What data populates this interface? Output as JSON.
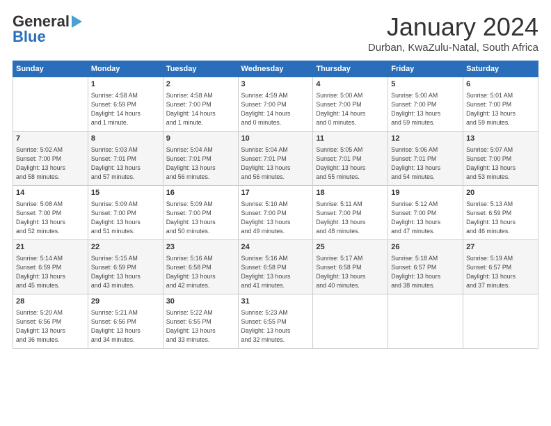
{
  "logo": {
    "general": "General",
    "blue": "Blue"
  },
  "title": "January 2024",
  "subtitle": "Durban, KwaZulu-Natal, South Africa",
  "days_header": [
    "Sunday",
    "Monday",
    "Tuesday",
    "Wednesday",
    "Thursday",
    "Friday",
    "Saturday"
  ],
  "weeks": [
    [
      {
        "day": "",
        "info": ""
      },
      {
        "day": "1",
        "info": "Sunrise: 4:58 AM\nSunset: 6:59 PM\nDaylight: 14 hours\nand 1 minute."
      },
      {
        "day": "2",
        "info": "Sunrise: 4:58 AM\nSunset: 7:00 PM\nDaylight: 14 hours\nand 1 minute."
      },
      {
        "day": "3",
        "info": "Sunrise: 4:59 AM\nSunset: 7:00 PM\nDaylight: 14 hours\nand 0 minutes."
      },
      {
        "day": "4",
        "info": "Sunrise: 5:00 AM\nSunset: 7:00 PM\nDaylight: 14 hours\nand 0 minutes."
      },
      {
        "day": "5",
        "info": "Sunrise: 5:00 AM\nSunset: 7:00 PM\nDaylight: 13 hours\nand 59 minutes."
      },
      {
        "day": "6",
        "info": "Sunrise: 5:01 AM\nSunset: 7:00 PM\nDaylight: 13 hours\nand 59 minutes."
      }
    ],
    [
      {
        "day": "7",
        "info": "Sunrise: 5:02 AM\nSunset: 7:00 PM\nDaylight: 13 hours\nand 58 minutes."
      },
      {
        "day": "8",
        "info": "Sunrise: 5:03 AM\nSunset: 7:01 PM\nDaylight: 13 hours\nand 57 minutes."
      },
      {
        "day": "9",
        "info": "Sunrise: 5:04 AM\nSunset: 7:01 PM\nDaylight: 13 hours\nand 56 minutes."
      },
      {
        "day": "10",
        "info": "Sunrise: 5:04 AM\nSunset: 7:01 PM\nDaylight: 13 hours\nand 56 minutes."
      },
      {
        "day": "11",
        "info": "Sunrise: 5:05 AM\nSunset: 7:01 PM\nDaylight: 13 hours\nand 55 minutes."
      },
      {
        "day": "12",
        "info": "Sunrise: 5:06 AM\nSunset: 7:01 PM\nDaylight: 13 hours\nand 54 minutes."
      },
      {
        "day": "13",
        "info": "Sunrise: 5:07 AM\nSunset: 7:00 PM\nDaylight: 13 hours\nand 53 minutes."
      }
    ],
    [
      {
        "day": "14",
        "info": "Sunrise: 5:08 AM\nSunset: 7:00 PM\nDaylight: 13 hours\nand 52 minutes."
      },
      {
        "day": "15",
        "info": "Sunrise: 5:09 AM\nSunset: 7:00 PM\nDaylight: 13 hours\nand 51 minutes."
      },
      {
        "day": "16",
        "info": "Sunrise: 5:09 AM\nSunset: 7:00 PM\nDaylight: 13 hours\nand 50 minutes."
      },
      {
        "day": "17",
        "info": "Sunrise: 5:10 AM\nSunset: 7:00 PM\nDaylight: 13 hours\nand 49 minutes."
      },
      {
        "day": "18",
        "info": "Sunrise: 5:11 AM\nSunset: 7:00 PM\nDaylight: 13 hours\nand 48 minutes."
      },
      {
        "day": "19",
        "info": "Sunrise: 5:12 AM\nSunset: 7:00 PM\nDaylight: 13 hours\nand 47 minutes."
      },
      {
        "day": "20",
        "info": "Sunrise: 5:13 AM\nSunset: 6:59 PM\nDaylight: 13 hours\nand 46 minutes."
      }
    ],
    [
      {
        "day": "21",
        "info": "Sunrise: 5:14 AM\nSunset: 6:59 PM\nDaylight: 13 hours\nand 45 minutes."
      },
      {
        "day": "22",
        "info": "Sunrise: 5:15 AM\nSunset: 6:59 PM\nDaylight: 13 hours\nand 43 minutes."
      },
      {
        "day": "23",
        "info": "Sunrise: 5:16 AM\nSunset: 6:58 PM\nDaylight: 13 hours\nand 42 minutes."
      },
      {
        "day": "24",
        "info": "Sunrise: 5:16 AM\nSunset: 6:58 PM\nDaylight: 13 hours\nand 41 minutes."
      },
      {
        "day": "25",
        "info": "Sunrise: 5:17 AM\nSunset: 6:58 PM\nDaylight: 13 hours\nand 40 minutes."
      },
      {
        "day": "26",
        "info": "Sunrise: 5:18 AM\nSunset: 6:57 PM\nDaylight: 13 hours\nand 38 minutes."
      },
      {
        "day": "27",
        "info": "Sunrise: 5:19 AM\nSunset: 6:57 PM\nDaylight: 13 hours\nand 37 minutes."
      }
    ],
    [
      {
        "day": "28",
        "info": "Sunrise: 5:20 AM\nSunset: 6:56 PM\nDaylight: 13 hours\nand 36 minutes."
      },
      {
        "day": "29",
        "info": "Sunrise: 5:21 AM\nSunset: 6:56 PM\nDaylight: 13 hours\nand 34 minutes."
      },
      {
        "day": "30",
        "info": "Sunrise: 5:22 AM\nSunset: 6:55 PM\nDaylight: 13 hours\nand 33 minutes."
      },
      {
        "day": "31",
        "info": "Sunrise: 5:23 AM\nSunset: 6:55 PM\nDaylight: 13 hours\nand 32 minutes."
      },
      {
        "day": "",
        "info": ""
      },
      {
        "day": "",
        "info": ""
      },
      {
        "day": "",
        "info": ""
      }
    ]
  ]
}
